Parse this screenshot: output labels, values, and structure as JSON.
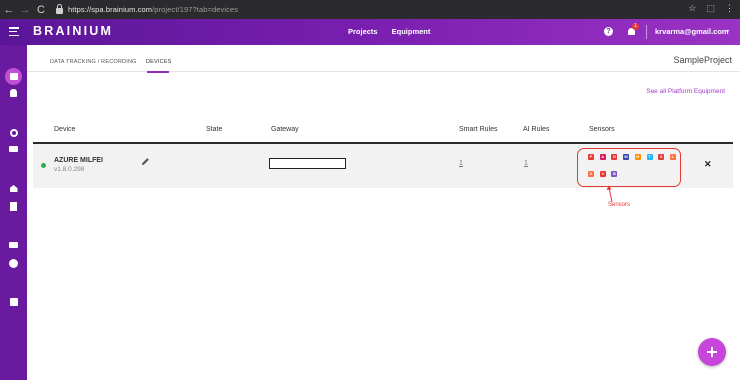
{
  "browser": {
    "back": "←",
    "forward": "→",
    "reload": "C",
    "url_host": "https://spa.brainium.com",
    "url_path": "/project/197?tab=devices",
    "right_icons": [
      "☆",
      "⬚",
      "⋮"
    ]
  },
  "header": {
    "logo": "BRAINIUM",
    "nav": [
      "Projects",
      "Equipment"
    ],
    "help_glyph": "?",
    "notification_count": "1",
    "user_email": "krvarma@gmail.com",
    "caret": "▾"
  },
  "tabs": [
    {
      "label": "DATA TRACKING / RECORDING",
      "active": false
    },
    {
      "label": "DEVICES",
      "active": true
    }
  ],
  "project_name": "SampleProject",
  "see_all_link": "See all Platform Equipment",
  "table": {
    "headers": [
      "Device",
      "State",
      "Gateway",
      "Smart Rules",
      "AI Rules",
      "Sensors"
    ],
    "row": {
      "name": "AZURE MILFEI",
      "version": "v1.8.0.298",
      "status_color": "#2bb24c",
      "gateway_value": "",
      "smart_rules": "1",
      "ai_rules": "1",
      "delete_glyph": "✕"
    }
  },
  "sensors": [
    {
      "icon": "pressure-sensor-icon",
      "color": "#e53935",
      "glyph": "P"
    },
    {
      "icon": "accelerometer-sensor-icon",
      "color": "#d81b60",
      "glyph": "A"
    },
    {
      "icon": "gyroscope-sensor-icon",
      "color": "#e53935",
      "glyph": "G"
    },
    {
      "icon": "magnetometer-sensor-icon",
      "color": "#3949ab",
      "glyph": "M"
    },
    {
      "icon": "humidity-sensor-icon",
      "color": "#ff8f00",
      "glyph": "H"
    },
    {
      "icon": "temperature-sensor-icon",
      "color": "#29b6f6",
      "glyph": "T"
    },
    {
      "icon": "sound-sensor-icon",
      "color": "#e53935",
      "glyph": "S"
    },
    {
      "icon": "light-sensor-icon",
      "color": "#ff7043",
      "glyph": "L"
    },
    {
      "icon": "proximity-sensor-icon",
      "color": "#ff7043",
      "glyph": "X"
    },
    {
      "icon": "motion-sensor-icon",
      "color": "#e53935",
      "glyph": "V"
    },
    {
      "icon": "battery-sensor-icon",
      "color": "#7e57c2",
      "glyph": "B"
    }
  ],
  "annotation": "Sensors",
  "fab_label": "+",
  "colors": {
    "header_start": "#5a1698",
    "header_end": "#9b33c4",
    "sidebar": "#6a1a9e",
    "accent": "#a13ac9",
    "annotation": "#e53935"
  }
}
